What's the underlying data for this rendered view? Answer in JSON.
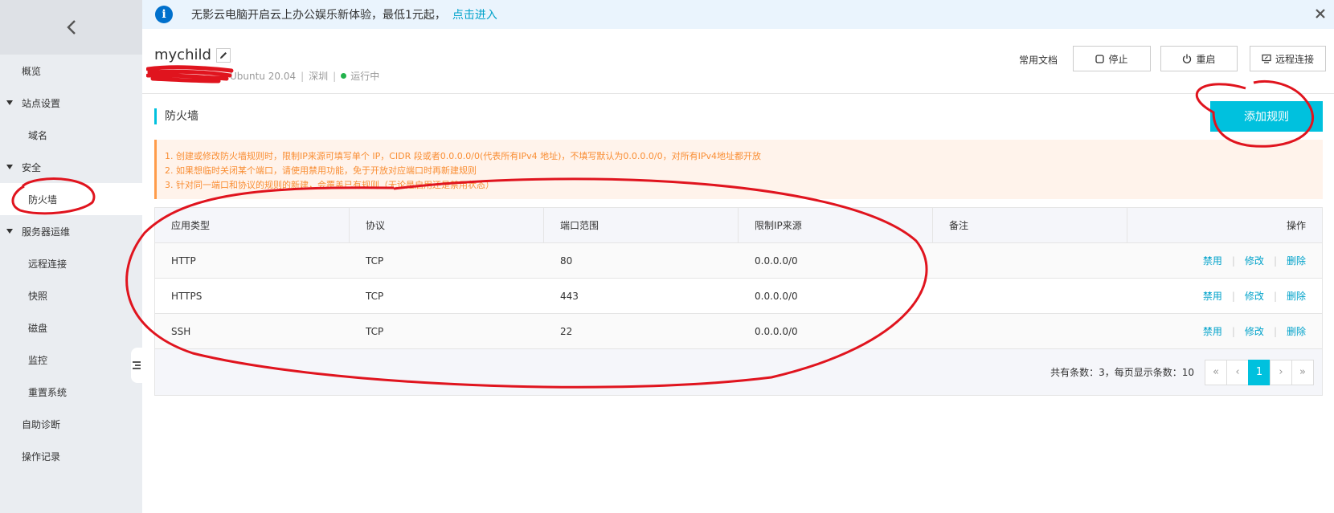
{
  "notice": {
    "text": "无影云电脑开启云上办公娱乐新体验，最低1元起，",
    "link": "点击进入"
  },
  "sidebar": {
    "items": [
      {
        "label": "概览",
        "type": "top"
      },
      {
        "label": "站点设置",
        "type": "group"
      },
      {
        "label": "域名",
        "type": "sub"
      },
      {
        "label": "安全",
        "type": "group"
      },
      {
        "label": "防火墙",
        "type": "sub",
        "active": true
      },
      {
        "label": "服务器运维",
        "type": "group"
      },
      {
        "label": "远程连接",
        "type": "sub"
      },
      {
        "label": "快照",
        "type": "sub"
      },
      {
        "label": "磁盘",
        "type": "sub"
      },
      {
        "label": "监控",
        "type": "sub"
      },
      {
        "label": "重置系统",
        "type": "sub"
      },
      {
        "label": "自助诊断",
        "type": "top"
      },
      {
        "label": "操作记录",
        "type": "top"
      }
    ]
  },
  "header": {
    "title": "mychild",
    "os": "Ubuntu 20.04",
    "region": "深圳",
    "status": "运行中",
    "status_color": "#22b24c"
  },
  "actions": {
    "docs": "常用文档",
    "stop": "停止",
    "restart": "重启",
    "remote": "远程连接"
  },
  "section": {
    "title": "防火墙",
    "add_button": "添加规则"
  },
  "warnings": [
    "1. 创建或修改防火墙规则时，限制IP来源可填写单个 IP，CIDR 段或者0.0.0.0/0(代表所有IPv4 地址)，不填写默认为0.0.0.0/0，对所有IPv4地址都开放",
    "2. 如果想临时关闭某个端口，请使用禁用功能，免于开放对应端口时再新建规则",
    "3. 针对同一端口和协议的规则的新建，会覆盖已有规则（无论是启用还是禁用状态）"
  ],
  "table": {
    "headers": [
      "应用类型",
      "协议",
      "端口范围",
      "限制IP来源",
      "备注",
      "操作"
    ],
    "rows": [
      {
        "app": "HTTP",
        "protocol": "TCP",
        "port": "80",
        "ip": "0.0.0.0/0",
        "note": ""
      },
      {
        "app": "HTTPS",
        "protocol": "TCP",
        "port": "443",
        "ip": "0.0.0.0/0",
        "note": ""
      },
      {
        "app": "SSH",
        "protocol": "TCP",
        "port": "22",
        "ip": "0.0.0.0/0",
        "note": ""
      }
    ],
    "ops": {
      "disable": "禁用",
      "edit": "修改",
      "delete": "删除",
      "sep": "|"
    },
    "footer": "共有条数：3，每页显示条数：10",
    "pager": [
      "«",
      "‹",
      "1",
      "›",
      "»"
    ],
    "current_page": "1"
  },
  "colors": {
    "accent": "#00c1de",
    "link": "#00a2ca",
    "warning": "#f98e34",
    "annotation": "#e0141e"
  }
}
